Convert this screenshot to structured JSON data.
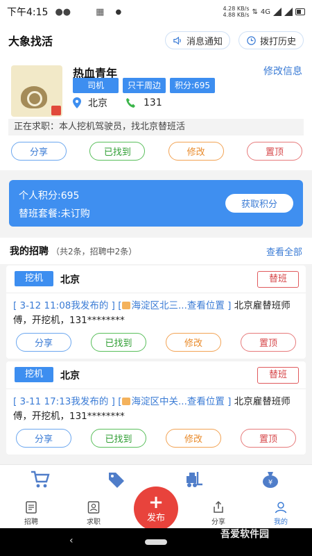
{
  "status_bar": {
    "time": "下午4:15",
    "net_up": "4.28 KB/s",
    "net_down": "4.88 KB/s",
    "signal_labels": "4G"
  },
  "header": {
    "app_title": "大象找活",
    "notify_label": "消息通知",
    "history_label": "拨打历史"
  },
  "profile": {
    "nickname": "热血青年",
    "edit_label": "修改信息",
    "tags": [
      "司机",
      "只干周边",
      "积分:695"
    ],
    "city": "北京",
    "phone": "131",
    "seeking": "正在求职：本人挖机驾驶员，找北京替班活",
    "actions": [
      "分享",
      "已找到",
      "修改",
      "置顶"
    ]
  },
  "points": {
    "personal": "个人积分:695",
    "plan": "替班套餐:未订购",
    "get_label": "获取积分"
  },
  "jobs": {
    "title": "我的招聘",
    "count_text": "（共2条，招聘中2条）",
    "view_all": "查看全部",
    "items": [
      {
        "type": "挖机",
        "city": "北京",
        "sub_label": "替班",
        "meta": "[ 3-12 11:08我发布的 ] [",
        "loc": "海淀区北三...查看位置 ]",
        "desc": " 北京雇替班师傅，开挖机，131********"
      },
      {
        "type": "挖机",
        "city": "北京",
        "sub_label": "替班",
        "meta": "[ 3-11 17:13我发布的 ] [",
        "loc": "海淀区中关...查看位置 ]",
        "desc": " 北京雇替班师傅，开挖机，131********"
      }
    ],
    "actions": [
      "分享",
      "已找到",
      "修改",
      "置顶"
    ]
  },
  "tabbar": {
    "tabs": [
      "招聘",
      "求职",
      "分享",
      "我的"
    ],
    "publish": "发布",
    "active": "我的"
  },
  "watermark": "吾爱软件园"
}
